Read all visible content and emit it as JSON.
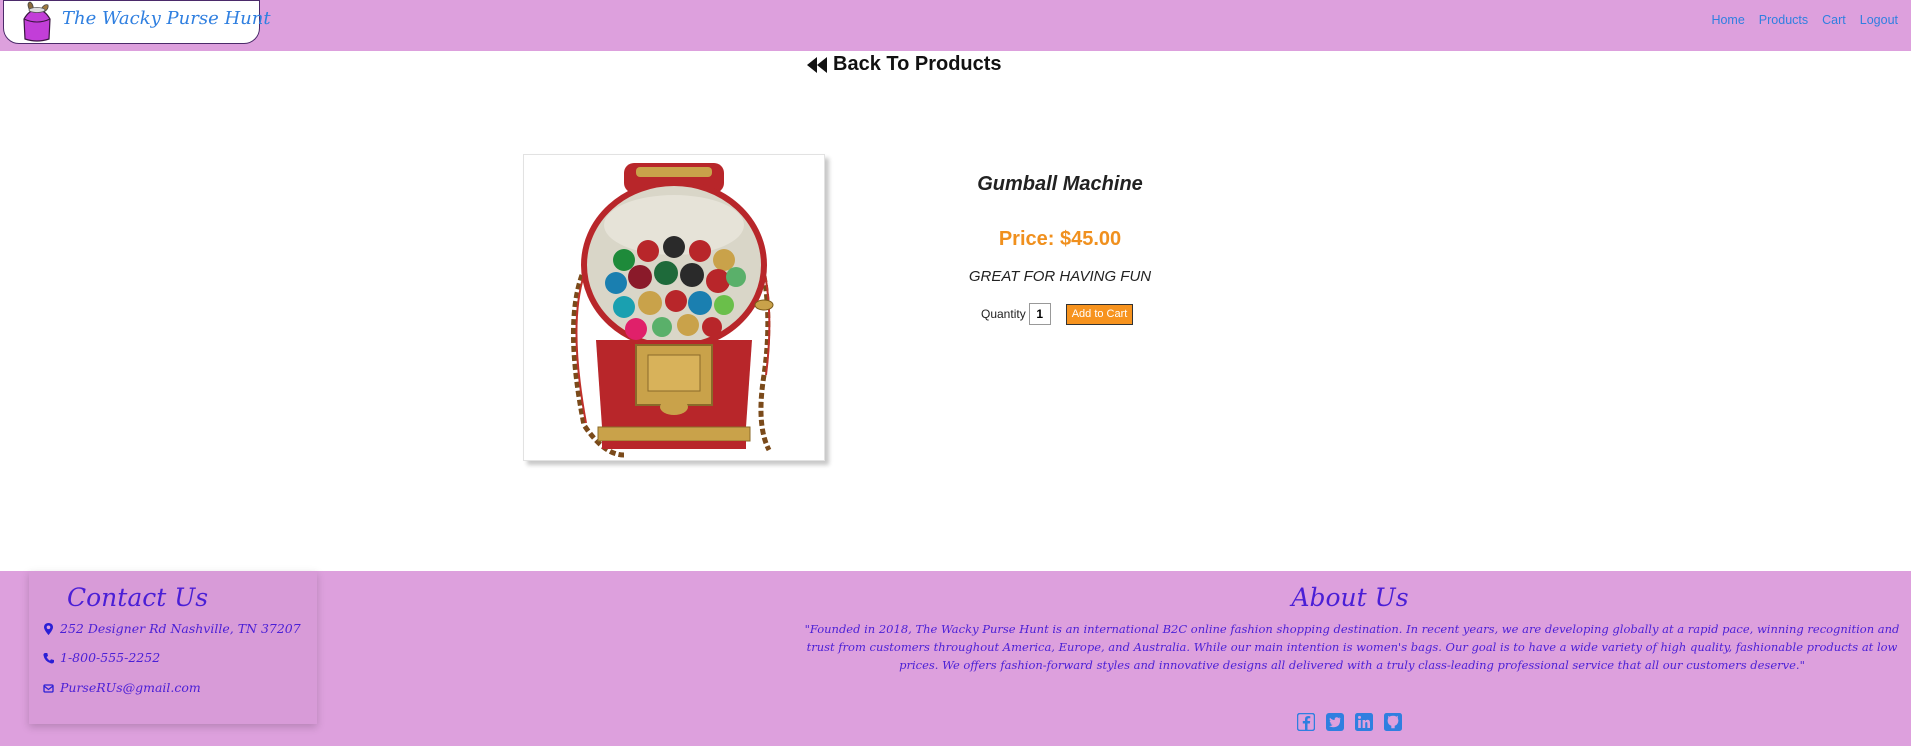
{
  "navbar": {
    "brand_name": "The Wacky Purse Hunt",
    "logo_icon": "purse-logo-icon",
    "links": [
      {
        "label": "Home"
      },
      {
        "label": "Products"
      },
      {
        "label": "Cart"
      },
      {
        "label": "Logout"
      }
    ],
    "link_color": "#2f7fe0",
    "background": "#dda0dd"
  },
  "back": {
    "label": "Back To Products",
    "icon": "backward-icon"
  },
  "product": {
    "title": "Gumball Machine",
    "price": "Price: $45.00",
    "tagline": "GREAT FOR HAVING FUN",
    "quantity_label": "Quantity",
    "quantity_value": "1",
    "add_to_cart_label": "Add to Cart",
    "price_color": "#f0901e",
    "button_color": "#f7931e"
  },
  "footer": {
    "contact": {
      "heading": "Contact Us",
      "address": "252 Designer Rd Nashville, TN 37207",
      "phone": "1-800-555-2252",
      "email": "PurseRUs@gmail.com"
    },
    "about": {
      "heading": "About Us",
      "text": "\"Founded in 2018, The Wacky Purse Hunt is an international B2C online fashion shopping destination. In recent years, we are developing globally at a rapid pace, winning recognition and trust from customers throughout America, Europe, and Australia. While our main intention is women's bags. Our goal is to have a wide variety of high quality, fashionable products at low prices. We offers fashion-forward styles and innovative designs all delivered with a truly class-leading professional service that all our customers deserve.\""
    },
    "social_icons": [
      "facebook-icon",
      "twitter-icon",
      "linkedin-icon",
      "github-icon"
    ],
    "text_color": "#4a1fd6",
    "social_color": "#2f7fe0"
  }
}
